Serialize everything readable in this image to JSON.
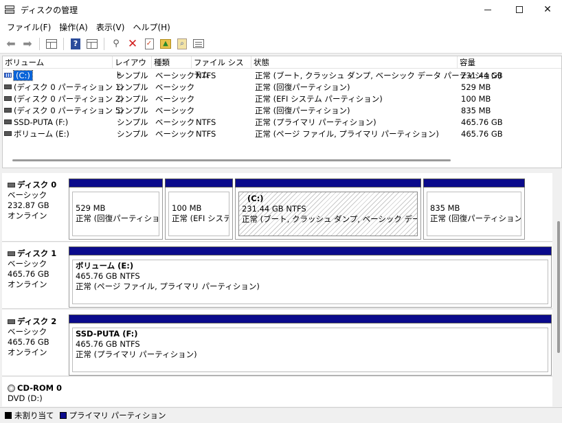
{
  "window": {
    "title": "ディスクの管理"
  },
  "menu": [
    "ファイル(F)",
    "操作(A)",
    "表示(V)",
    "ヘルプ(H)"
  ],
  "volume_list": {
    "columns": [
      "ボリューム",
      "レイアウト",
      "種類",
      "ファイル システム",
      "状態",
      "容量"
    ],
    "rows": [
      {
        "name": "(C:)",
        "layout": "シンプル",
        "type": "ベーシック",
        "fs": "NTFS",
        "status": "正常 (ブート, クラッシュ ダンプ, ベーシック データ パーティション)",
        "capacity": "231.44 GB",
        "selected": true
      },
      {
        "name": "(ディスク 0 パーティション 1)",
        "layout": "シンプル",
        "type": "ベーシック",
        "fs": "",
        "status": "正常 (回復パーティション)",
        "capacity": "529 MB"
      },
      {
        "name": "(ディスク 0 パーティション 2)",
        "layout": "シンプル",
        "type": "ベーシック",
        "fs": "",
        "status": "正常 (EFI システム パーティション)",
        "capacity": "100 MB"
      },
      {
        "name": "(ディスク 0 パーティション 5)",
        "layout": "シンプル",
        "type": "ベーシック",
        "fs": "",
        "status": "正常 (回復パーティション)",
        "capacity": "835 MB"
      },
      {
        "name": "SSD-PUTA (F:)",
        "layout": "シンプル",
        "type": "ベーシック",
        "fs": "NTFS",
        "status": "正常 (プライマリ パーティション)",
        "capacity": "465.76 GB"
      },
      {
        "name": "ボリューム (E:)",
        "layout": "シンプル",
        "type": "ベーシック",
        "fs": "NTFS",
        "status": "正常 (ページ ファイル, プライマリ パーティション)",
        "capacity": "465.76 GB"
      }
    ]
  },
  "disks": [
    {
      "name": "ディスク 0",
      "kind": "ベーシック",
      "size": "232.87 GB",
      "state": "オンライン",
      "partitions": [
        {
          "line1": "529 MB",
          "line2": "正常 (回復パーティション)"
        },
        {
          "line1": "100 MB",
          "line2": "正常 (EFI システム"
        },
        {
          "title": "(C:)",
          "line1": "231.44 GB NTFS",
          "line2": "正常 (ブート, クラッシュ ダンプ, ベーシック データ パーティシ"
        },
        {
          "line1": "835 MB",
          "line2": "正常 (回復パーティション)"
        }
      ]
    },
    {
      "name": "ディスク 1",
      "kind": "ベーシック",
      "size": "465.76 GB",
      "state": "オンライン",
      "partitions": [
        {
          "title": "ボリューム  (E:)",
          "line1": "465.76 GB NTFS",
          "line2": "正常 (ページ ファイル, プライマリ パーティション)"
        }
      ]
    },
    {
      "name": "ディスク 2",
      "kind": "ベーシック",
      "size": "465.76 GB",
      "state": "オンライン",
      "partitions": [
        {
          "title": "SSD-PUTA  (F:)",
          "line1": "465.76 GB NTFS",
          "line2": "正常 (プライマリ パーティション)"
        }
      ]
    },
    {
      "name": "CD-ROM 0",
      "kind": "DVD (D:)"
    }
  ],
  "legend": [
    {
      "label": "未割り当て",
      "color": "#000000"
    },
    {
      "label": "プライマリ パーティション",
      "color": "#0b0b8c"
    }
  ]
}
